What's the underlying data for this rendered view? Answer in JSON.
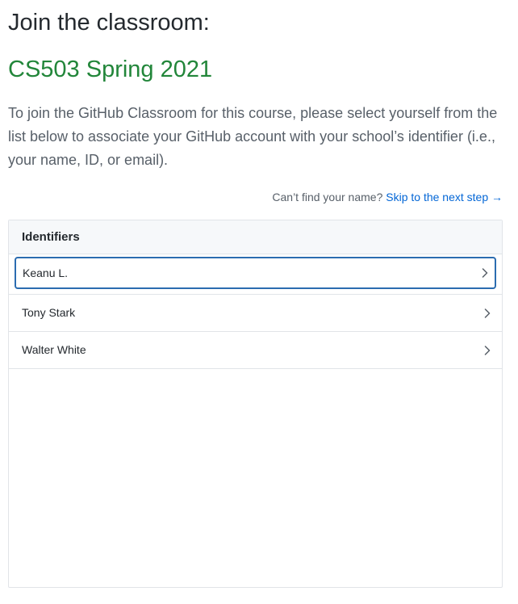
{
  "header": {
    "title": "Join the classroom:",
    "course": "CS503 Spring 2021"
  },
  "intro": "To join the GitHub Classroom for this course, please select yourself from the list below to associate your GitHub account with your school’s identifier (i.e., your name, ID, or email).",
  "skip": {
    "prompt": "Can’t find your name?",
    "link_label": "Skip to the next step →"
  },
  "identifiers": {
    "heading": "Identifiers",
    "items": [
      {
        "label": "Keanu L.",
        "selected": true
      },
      {
        "label": "Tony Stark",
        "selected": false
      },
      {
        "label": "Walter White",
        "selected": false
      }
    ]
  },
  "colors": {
    "course": "#22863a",
    "link": "#0366d6",
    "focus_border": "#2b6cb0"
  },
  "icons": {
    "row_chevron": "chevron-right-icon"
  }
}
